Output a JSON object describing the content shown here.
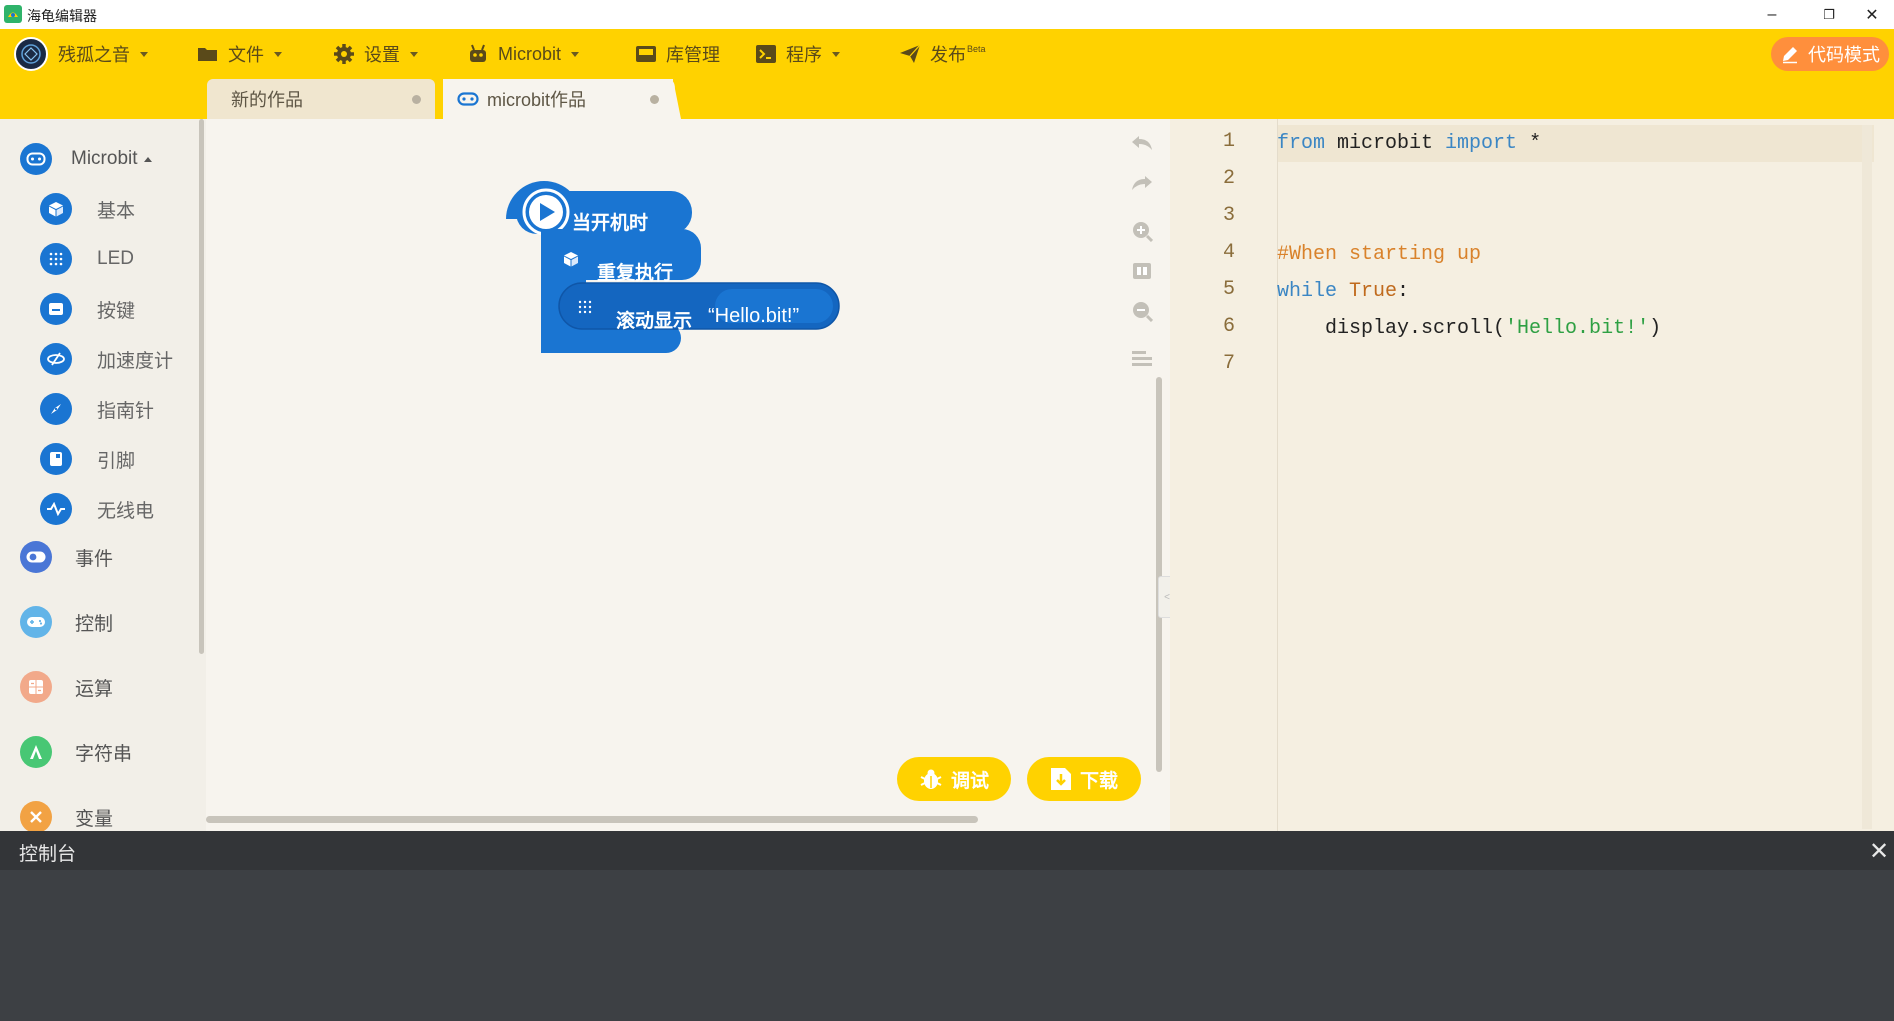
{
  "window": {
    "title": "海龟编辑器",
    "controls": {
      "minimize": "–",
      "restore": "❐",
      "close": "✕"
    }
  },
  "menu": {
    "user": "残孤之音",
    "file": "文件",
    "settings": "设置",
    "device": "Microbit",
    "library": "库管理",
    "program": "程序",
    "publish": "发布",
    "publish_badge": "Beta",
    "code_mode": "代码模式"
  },
  "tabs": [
    {
      "label": "新的作品"
    },
    {
      "label": "microbit作品"
    }
  ],
  "sidebar": {
    "categories": [
      {
        "label": "Microbit",
        "icon": "microbit-icon",
        "color": "#1a75d2"
      },
      {
        "label": "事件",
        "icon": "toggle-icon",
        "color": "#4a76d6"
      },
      {
        "label": "控制",
        "icon": "gamepad-icon",
        "color": "#62b4e8"
      },
      {
        "label": "运算",
        "icon": "calculator-icon",
        "color": "#f2a98a"
      },
      {
        "label": "字符串",
        "icon": "letter-a-icon",
        "color": "#48c774"
      },
      {
        "label": "变量",
        "icon": "variable-icon",
        "color": "#f2a243"
      }
    ],
    "subcategories": [
      {
        "label": "基本",
        "icon": "cube-icon"
      },
      {
        "label": "LED",
        "icon": "led-grid-icon"
      },
      {
        "label": "按键",
        "icon": "button-icon"
      },
      {
        "label": "加速度计",
        "icon": "accelerometer-icon"
      },
      {
        "label": "指南针",
        "icon": "compass-icon"
      },
      {
        "label": "引脚",
        "icon": "pin-icon"
      },
      {
        "label": "无线电",
        "icon": "radio-wave-icon"
      }
    ]
  },
  "blocks": {
    "start": "当开机时",
    "forever": "重复执行",
    "scroll": "滚动显示",
    "scroll_text": "“Hello.bit!”",
    "color": "#1a75d2"
  },
  "actions": {
    "debug": "调试",
    "download": "下载"
  },
  "editor": {
    "line_numbers": [
      "1",
      "2",
      "3",
      "4",
      "5",
      "6",
      "7"
    ],
    "lines": [
      [
        {
          "t": "from",
          "c": "kw"
        },
        {
          "t": " microbit ",
          "c": "pl"
        },
        {
          "t": "import",
          "c": "kw"
        },
        {
          "t": " *",
          "c": "pl"
        }
      ],
      [],
      [],
      [
        {
          "t": "#When starting up",
          "c": "cm"
        }
      ],
      [
        {
          "t": "while",
          "c": "kw"
        },
        {
          "t": " ",
          "c": "pl"
        },
        {
          "t": "True",
          "c": "bi"
        },
        {
          "t": ":",
          "c": "pl"
        }
      ],
      [
        {
          "t": "    display.scroll(",
          "c": "pl"
        },
        {
          "t": "'Hello.bit!'",
          "c": "st"
        },
        {
          "t": ")",
          "c": "pl"
        }
      ],
      []
    ]
  },
  "console": {
    "title": "控制台",
    "close": "✕"
  },
  "colors": {
    "accent": "#ffd200",
    "code_mode": "#ff8f3c",
    "block_blue": "#1a75d2",
    "console_bg": "#3d4044"
  }
}
